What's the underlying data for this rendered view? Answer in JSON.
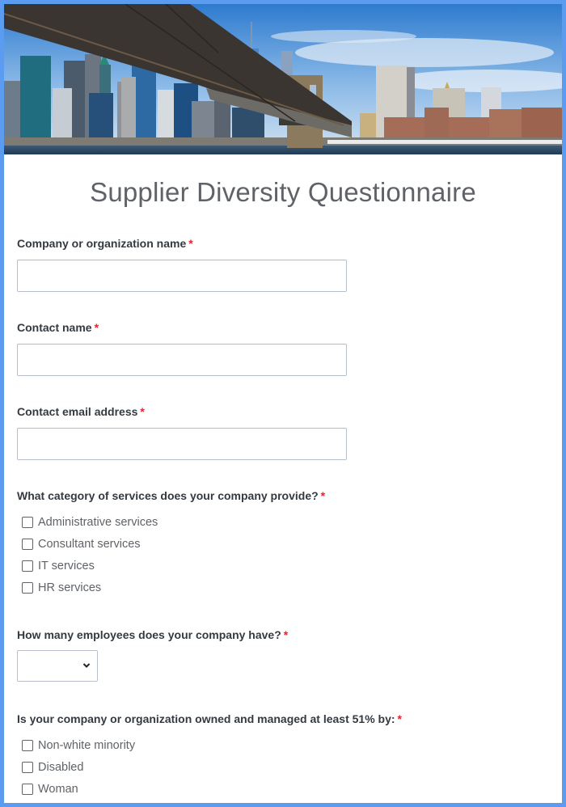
{
  "banner": {
    "image_description": "New York City skyline with Brooklyn Bridge"
  },
  "form": {
    "title": "Supplier Diversity Questionnaire",
    "required_marker": "*",
    "fields": [
      {
        "label": "Company or organization name",
        "value": "",
        "placeholder": ""
      },
      {
        "label": "Contact name",
        "value": "",
        "placeholder": ""
      },
      {
        "label": "Contact email address",
        "value": "",
        "placeholder": ""
      }
    ],
    "services": {
      "label": "What category of services does your company provide?",
      "options": [
        {
          "label": "Administrative services",
          "checked": false
        },
        {
          "label": "Consultant services",
          "checked": false
        },
        {
          "label": "IT services",
          "checked": false
        },
        {
          "label": "HR services",
          "checked": false
        }
      ]
    },
    "employees": {
      "label": "How many employees does your company have?",
      "selected": ""
    },
    "ownership": {
      "label": "Is your company or organization owned and managed at least 51% by:",
      "options": [
        {
          "label": "Non-white minority",
          "checked": false
        },
        {
          "label": "Disabled",
          "checked": false
        },
        {
          "label": "Woman",
          "checked": false
        }
      ]
    }
  },
  "colors": {
    "frame": "#5b9cf0",
    "required": "#e0262f",
    "title": "#5f6368"
  }
}
